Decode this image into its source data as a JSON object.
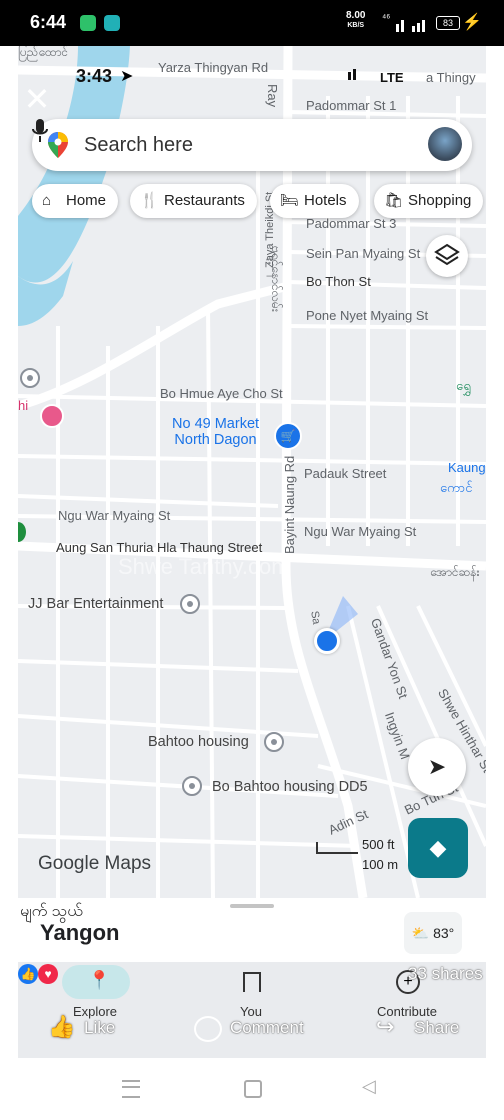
{
  "phone_status": {
    "time": "6:44",
    "net_speed": "8.00",
    "net_unit": "KB/S",
    "signal": "⁴⁶",
    "battery": "83"
  },
  "inner_status": {
    "time": "3:43",
    "carrier": "LTE"
  },
  "search": {
    "placeholder": "Search here"
  },
  "chips": [
    {
      "label": "Home",
      "icon": "home-icon"
    },
    {
      "label": "Restaurants",
      "icon": "fork-knife-icon"
    },
    {
      "label": "Hotels",
      "icon": "bed-icon"
    },
    {
      "label": "Shopping",
      "icon": "shopping-bag-icon"
    }
  ],
  "streets": {
    "yarza": "Yarza Thingyan Rd",
    "padommar1": "Padommar St 1",
    "padommar3": "Padommar St 3",
    "sein_pan": "Sein Pan Myaing St",
    "bo_thon": "Bo Thon St",
    "pone_nyet": "Pone Nyet Myaing St",
    "bo_hmue": "Bo Hmue Aye Cho St",
    "padauk": "Padauk Street",
    "ngu_war_left": "Ngu War Myaing St",
    "ngu_war_right": "Ngu War Myaing St",
    "aung_san": "Aung San Thuria Hla Thaung Street",
    "bayint": "Bayint Naung Rd",
    "zaya": "Zaya Theikdi St",
    "gandar": "Gandar Yon St",
    "ingyin": "Ingyin M",
    "shwe_hinthar": "Shwe Hinthar St",
    "adin": "Adin St",
    "tun_st": "Bo  Tun St",
    "top_left": "ပြည်ထောင်",
    "top_right": "a Thingy",
    "ray": "Ray",
    "my_road": "ဗရင့်နောင်လမ်း",
    "my_right": "အောင်ဆန်း",
    "kaung": "Kaung",
    "kaung_my": "ကောင်",
    "right_my": "ရွှေ",
    "sa": "Sa",
    "hi": "hi"
  },
  "pois": {
    "market": "No 49 Market\nNorth Dagon",
    "jj_bar": "JJ Bar Entertainment",
    "bahtoo": "Bahtoo housing",
    "bo_bahtoo": "Bo Bahtoo housing DD5"
  },
  "watermark": "Shwe Tanthy.com",
  "scale": {
    "feet": "500 ft",
    "meters": "100 m"
  },
  "brand": "Google Maps",
  "sheet": {
    "my_text": "မျက် သွယ်",
    "place": "Yangon",
    "weather": "83°"
  },
  "bottom_nav": [
    {
      "label": "Explore"
    },
    {
      "label": "You"
    },
    {
      "label": "Contribute"
    }
  ],
  "facebook": {
    "like": "Like",
    "comment": "Comment",
    "share": "Share",
    "shares_count": "33 shares"
  },
  "colors": {
    "accent": "#1a73e8",
    "directions": "#0b7a8a",
    "river": "#9fd6ec"
  }
}
